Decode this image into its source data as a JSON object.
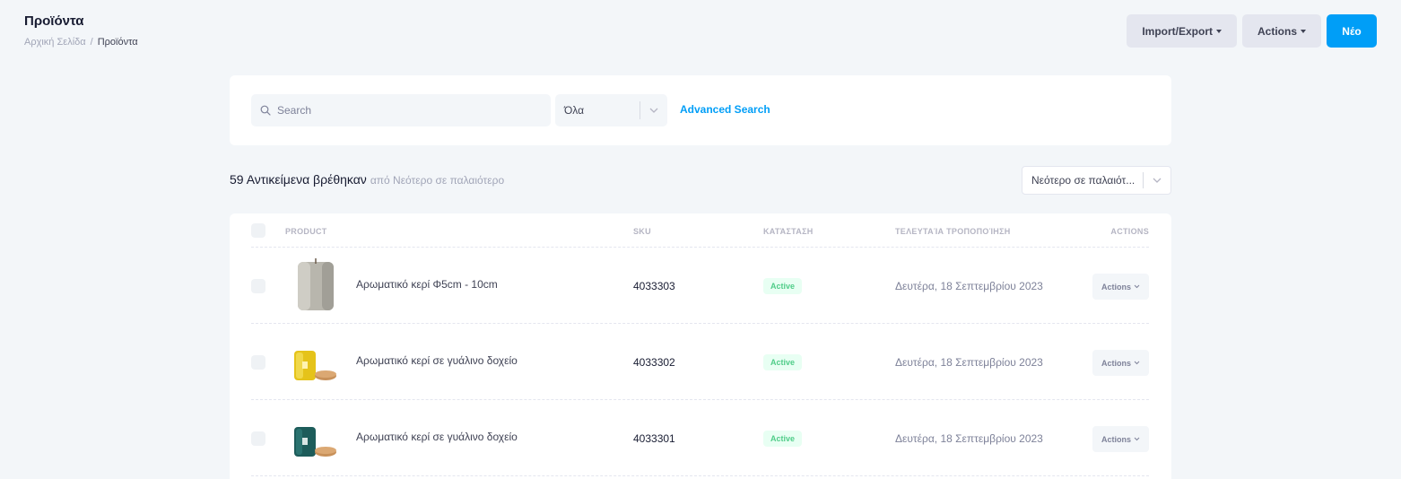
{
  "header": {
    "title": "Προϊόντα",
    "breadcrumb": {
      "home": "Αρχική Σελίδα",
      "separator": "/",
      "current": "Προϊόντα"
    },
    "buttons": {
      "import_export": "Import/Export",
      "actions": "Actions",
      "new": "Νέο"
    }
  },
  "search": {
    "placeholder": "Search",
    "filter_value": "Όλα",
    "advanced_link": "Advanced Search"
  },
  "results": {
    "count_text": "59 Αντικείμενα βρέθηκαν",
    "sort_description": "από Νεότερο σε παλαιότερο",
    "sort_select_value": "Νεότερο σε παλαιότ..."
  },
  "table": {
    "columns": {
      "product": "PRODUCT",
      "sku": "SKU",
      "status": "ΚΑΤΆΣΤΑΣΗ",
      "modified": "ΤΕΛΕΥΤΑΊΑ ΤΡΟΠΟΠΟΊΗΣΗ",
      "actions": "ACTIONS"
    },
    "rows": [
      {
        "name": "Αρωματικό κερί Φ5cm - 10cm",
        "sku": "4033303",
        "status": "Active",
        "modified": "Δευτέρα, 18 Σεπτεμβρίου 2023",
        "action_label": "Actions"
      },
      {
        "name": "Αρωματικό κερί σε γυάλινο δοχείο",
        "sku": "4033302",
        "status": "Active",
        "modified": "Δευτέρα, 18 Σεπτεμβρίου 2023",
        "action_label": "Actions"
      },
      {
        "name": "Αρωματικό κερί σε γυάλινο δοχείο",
        "sku": "4033301",
        "status": "Active",
        "modified": "Δευτέρα, 18 Σεπτεμβρίου 2023",
        "action_label": "Actions"
      }
    ]
  },
  "colors": {
    "primary": "#009ef7",
    "light_button": "#e4e6ef",
    "background": "#f3f6f9",
    "success_text": "#50cd89",
    "success_bg": "#e8fff3"
  }
}
